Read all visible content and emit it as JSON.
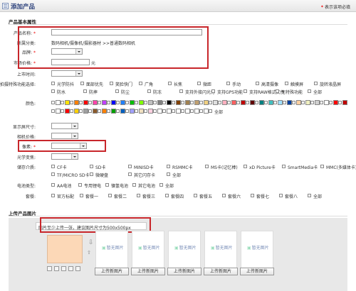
{
  "header": {
    "title": "添加产品",
    "required_note_mark": "*",
    "required_note": "表示该项必填"
  },
  "basic_section": {
    "title": "产品基本属性"
  },
  "fields": {
    "name_label": "产品名称:",
    "category_label": "所属分类:",
    "category_value": "数码相机/摄像机/摄影器材 >>普通数码相机",
    "brand_label": "品牌:",
    "price_label": "市场价格:",
    "price_unit": "元",
    "launch_label": "上市时间:",
    "feature_label": "拍摄特殊功能选择:",
    "feature_opts_row1": [
      "光学防抖",
      "面部优先",
      "笑脸快门",
      "广角",
      "长焦",
      "微距",
      "手动",
      "高清摄像",
      "触摸屏",
      "旋转液晶屏"
    ],
    "feature_opts_row2": [
      "防水",
      "防摔",
      "防尘",
      "防冻",
      "支持外接闪光灯",
      "支持GPS功能",
      "支持RAW格式文件",
      "无特殊功能",
      "全部"
    ],
    "color_label": "颜色:",
    "color_all": "全部",
    "screen_label": "显示屏尺寸:",
    "body_price_label": "相机价格:",
    "pixel_label": "像素:",
    "optical_label": "光学变焦:",
    "storage_label": "储存介质:",
    "storage_opts_row1": [
      "CF卡",
      "SD卡",
      "MINISD卡",
      "RSMMC卡",
      "MS卡(记忆棒)",
      "xD Picture卡",
      "SmartMedia卡",
      "MMC(多媒体卡)"
    ],
    "storage_opts_row2": [
      "TF/MICRO SD卡",
      "微硬盘",
      "其它闪存卡",
      "全部"
    ],
    "battery_label": "电池类型:",
    "battery_opts": [
      "AA电池",
      "专用锂电",
      "镍氢电池",
      "其它电池",
      "全部"
    ],
    "package_label": "套餐:",
    "package_opts": [
      "官方标配",
      "套餐一",
      "套餐二",
      "套餐三",
      "套餐四",
      "套餐五",
      "套餐六",
      "套餐七",
      "套餐八",
      "全部"
    ]
  },
  "colors": {
    "row1": [
      "#ffffff",
      "#ffe400",
      "#ff8000",
      "#ff0000",
      "#ff44aa",
      "#c040ff",
      "#0000ff",
      "#2080ff",
      "#00c000",
      "#80ff00",
      "#c0c0c0",
      "#808080",
      "#000000",
      "#804000",
      "#a08050",
      "#c0a070",
      "#f0d080",
      "#e0e0e0",
      "#ffb0c0",
      "#ff6060",
      "#c00000",
      "#600000",
      "#008080",
      "#40c0c0",
      "#a0e0ff",
      "#0040a0",
      "#ffd0a0",
      "#f0f0c0",
      "#d0d0d0",
      "#ffffff",
      "#ff0000",
      "#c00000"
    ],
    "row2": [
      "#ffffff",
      "#ff0000",
      "#ffd000",
      "#a0a0a0",
      "#8b5a2b",
      "#ff8000",
      "#00a000",
      "#0060c0",
      "#a0a0ff",
      "#f0e0c0",
      "#ffd0e0",
      "#ffffff",
      "#ffffff",
      "#ffffff",
      "#ffffff",
      "#ffffff",
      "#ffffff"
    ]
  },
  "upload": {
    "title": "上传产品图片",
    "tip": "图片至少上传一张，建议图片尺寸为500x500px",
    "placeholder": "暂无图片",
    "button": "上传新图片",
    "accent": "#c8262b"
  }
}
